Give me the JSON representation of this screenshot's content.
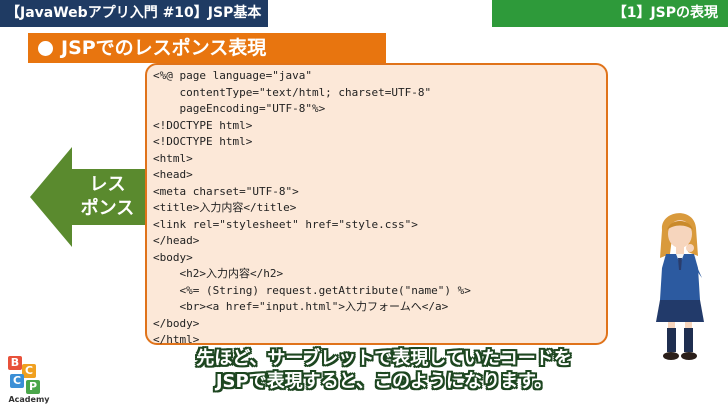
{
  "header": {
    "series_title": "【JavaWebアプリ入門 #10】JSP基本",
    "section_title": "【1】JSPの表現"
  },
  "slide": {
    "title": "JSPでのレスポンス表現",
    "arrow_label_line1": "レス",
    "arrow_label_line2": "ポンス"
  },
  "code": {
    "lines": [
      "<%@ page language=\"java\"",
      "    contentType=\"text/html; charset=UTF-8\"",
      "    pageEncoding=\"UTF-8\"%>",
      "<!DOCTYPE html>",
      "<!DOCTYPE html>",
      "<html>",
      "<head>",
      "<meta charset=\"UTF-8\">",
      "<title>入力内容</title>",
      "<link rel=\"stylesheet\" href=\"style.css\">",
      "</head>",
      "<body>",
      "    <h2>入力内容</h2>",
      "    <%= (String) request.getAttribute(\"name\") %>",
      "    <br><a href=\"input.html\">入力フォームへ</a>",
      "</body>",
      "</html>"
    ]
  },
  "subtitle": {
    "line1": "先ほど、サーブレットで表現していたコードを",
    "line2": "JSPで表現すると、このようになります。"
  },
  "logo": {
    "letters": [
      "B",
      "C",
      "C",
      "P"
    ],
    "label": "Academy"
  },
  "colors": {
    "header_left": "#1f3b63",
    "header_right": "#2e9a3a",
    "accent_orange": "#e8750f",
    "arrow_green": "#5a8a2e",
    "code_bg": "#fce8d8"
  }
}
